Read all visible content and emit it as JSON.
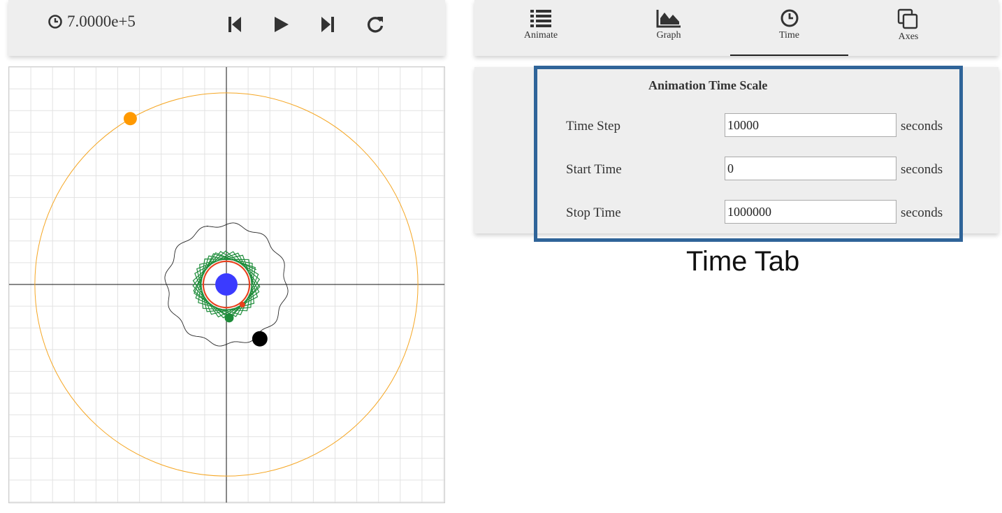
{
  "controls": {
    "time_icon": "clock-icon",
    "time_value": "7.0000e+5",
    "buttons": [
      "skip-start-icon",
      "play-icon",
      "skip-end-icon",
      "reload-icon"
    ]
  },
  "tabs": [
    {
      "label": "Animate",
      "icon": "list-icon"
    },
    {
      "label": "Graph",
      "icon": "area-chart-icon"
    },
    {
      "label": "Time",
      "icon": "clock-icon",
      "active": true
    },
    {
      "label": "Axes",
      "icon": "copy-icon"
    }
  ],
  "panel": {
    "title": "Animation Time Scale",
    "rows": [
      {
        "label": "Time Step",
        "value": "10000",
        "unit": "seconds"
      },
      {
        "label": "Start Time",
        "value": "0",
        "unit": "seconds"
      },
      {
        "label": "Stop Time",
        "value": "1000000",
        "unit": "seconds"
      }
    ]
  },
  "caption": "Time Tab",
  "colors": {
    "highlight": "#2f6499",
    "panel_bg": "#eeeeee",
    "outer_orbit": "#f5a623",
    "outer_body": "#ff9900",
    "inner_orbit": "#222222",
    "black_body": "#000000",
    "green": "#1e8c3a",
    "red": "#e8401c",
    "central_body": "#3b3bff",
    "grid": "#e0e0e0"
  }
}
